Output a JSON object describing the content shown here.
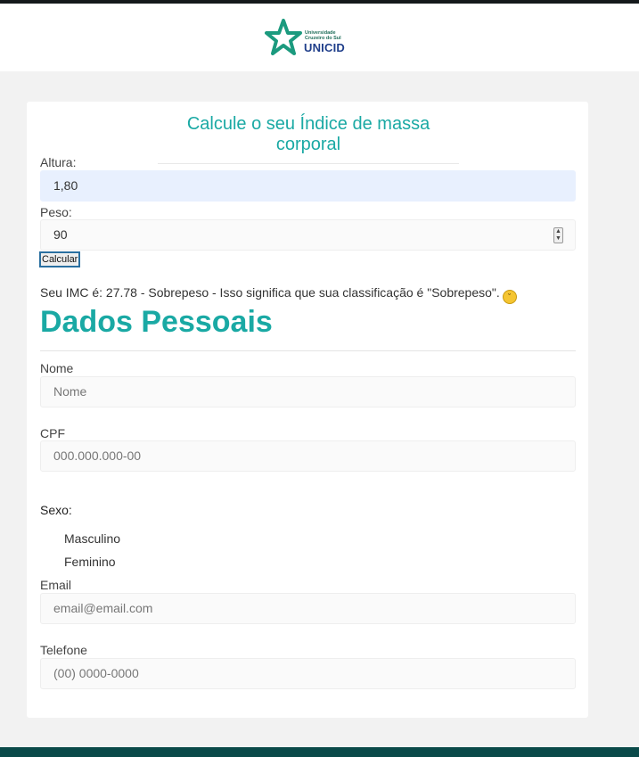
{
  "header": {
    "logo_line1": "Universidade",
    "logo_line2": "Cruzeiro do Sul",
    "logo_name": "UNICID",
    "logo_icon": "star-icon"
  },
  "imc": {
    "title": "Calcule o seu Índice de massa corporal",
    "altura_label": "Altura:",
    "altura_value": "1,80",
    "peso_label": "Peso:",
    "peso_value": "90",
    "button_label": "Calcular",
    "result_text": "Seu IMC é: 27.78 - Sobrepeso - Isso significa que sua classificação é \"Sobrepeso\".",
    "result_icon": "confused-face-emoji"
  },
  "personal": {
    "title": "Dados Pessoais",
    "nome_label": "Nome",
    "nome_placeholder": "Nome",
    "cpf_label": "CPF",
    "cpf_placeholder": "000.000.000-00",
    "sexo_label": "Sexo:",
    "sexo_options": [
      "Masculino",
      "Feminino"
    ],
    "email_label": "Email",
    "email_placeholder": "email@email.com",
    "telefone_label": "Telefone",
    "telefone_placeholder": "(00) 0000-0000"
  },
  "colors": {
    "accent": "#1aa9a4",
    "footer": "#0a4a49",
    "topbar": "#15191b"
  }
}
